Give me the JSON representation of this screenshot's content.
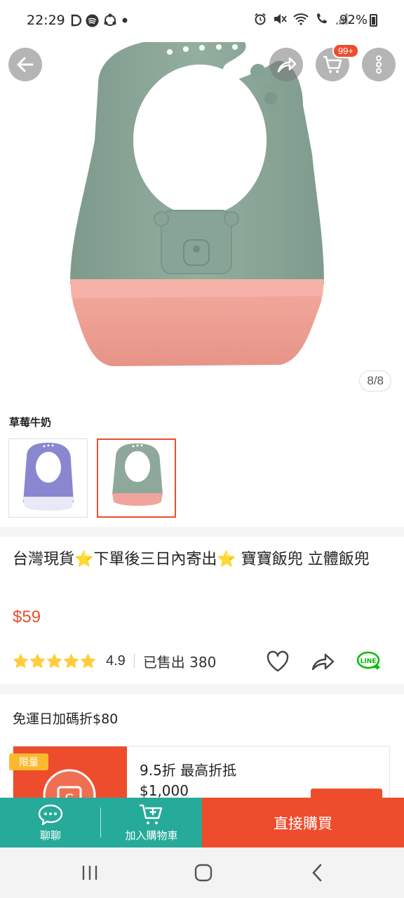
{
  "status_bar": {
    "time": "22:29",
    "battery": "92%",
    "left_icons": [
      "d-app-icon",
      "spotify-icon",
      "sync-icon",
      "dot-icon"
    ],
    "right_icons": [
      "alarm-icon",
      "mute-icon",
      "wifi-icon",
      "call-icon",
      "signal-icon"
    ]
  },
  "top_actions": {
    "cart_badge": "99+"
  },
  "gallery": {
    "counter": "8/8",
    "colors": {
      "bib_green": "#8ea99b",
      "bib_pink": "#f1a49b",
      "bib_purple": "#8a86d0"
    }
  },
  "variant": {
    "label": "草莓牛奶"
  },
  "product": {
    "title": "台灣現貨⭐下單後三日內寄出⭐ 寶寶飯兜 立體飯兜",
    "price": "$59",
    "rating": "4.9",
    "rating_stars": 4.9,
    "sold": "已售出 380"
  },
  "voucher": {
    "section_title": "免運日加碼折$80",
    "tag": "限量",
    "line1": "9.5折 最高折抵",
    "line2": "$1,000"
  },
  "bottom_bar": {
    "chat_label": "聊聊",
    "cart_label": "加入購物車",
    "buy_label": "直接購買"
  },
  "theme": {
    "accent": "#ee4d2d",
    "teal": "#26aa99",
    "star": "#ffce3d"
  }
}
